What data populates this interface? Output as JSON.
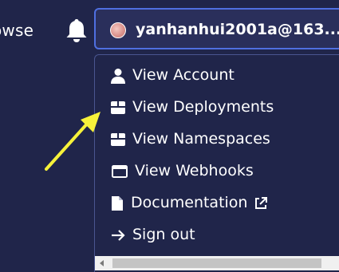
{
  "header": {
    "nav_partial_label": "owse",
    "bell_icon": "bell-icon",
    "account_email": "yanhanhui2001a@163....",
    "avatar_icon": "avatar"
  },
  "menu": {
    "items": [
      {
        "label": "View Account",
        "icon": "user-icon"
      },
      {
        "label": "View Deployments",
        "icon": "box-icon"
      },
      {
        "label": "View Namespaces",
        "icon": "box-icon"
      },
      {
        "label": "View Webhooks",
        "icon": "window-icon"
      },
      {
        "label": "Documentation",
        "icon": "document-icon",
        "trailing_icon": "external-link-icon"
      },
      {
        "label": "Sign out",
        "icon": "arrow-right-icon"
      }
    ]
  },
  "colors": {
    "background": "#20254a",
    "button_border": "#4f6fe0",
    "annotation_arrow": "#f7f23a"
  }
}
